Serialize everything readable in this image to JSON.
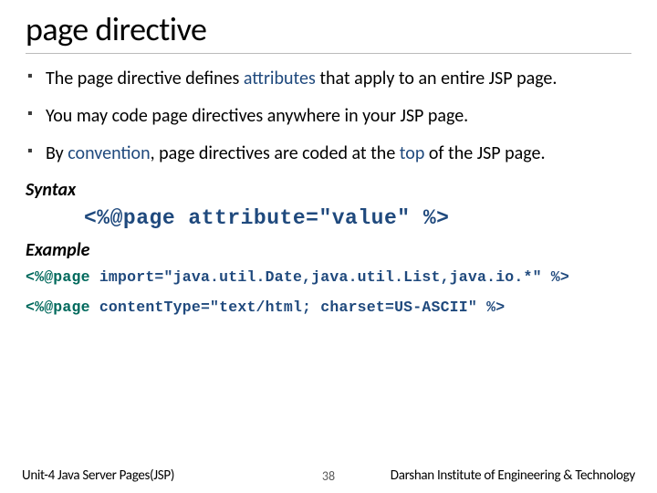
{
  "title": "page directive",
  "bullets": [
    {
      "pre": "The page directive defines ",
      "em": "attributes",
      "post": " that apply to an entire JSP page."
    },
    {
      "text": "You may code page directives anywhere in your JSP page."
    },
    {
      "pre": "By ",
      "em1": "convention",
      "mid": ", page directives are coded at the ",
      "em2": "top",
      "post": " of the JSP page."
    }
  ],
  "syntax_label": "Syntax",
  "syntax_code": "<%@page attribute=\"value\" %>",
  "example_label": "Example",
  "example_lines": [
    {
      "tag": "<%@page",
      "rest": " import=\"java.util.Date,java.util.List,java.io.*\" %>"
    },
    {
      "tag": "<%@page",
      "rest": " contentType=\"text/html; charset=US-ASCII\" %>"
    }
  ],
  "footer": {
    "left": "Unit-4 Java Server Pages(JSP)",
    "center": "38",
    "right": "Darshan Institute of Engineering & Technology"
  }
}
